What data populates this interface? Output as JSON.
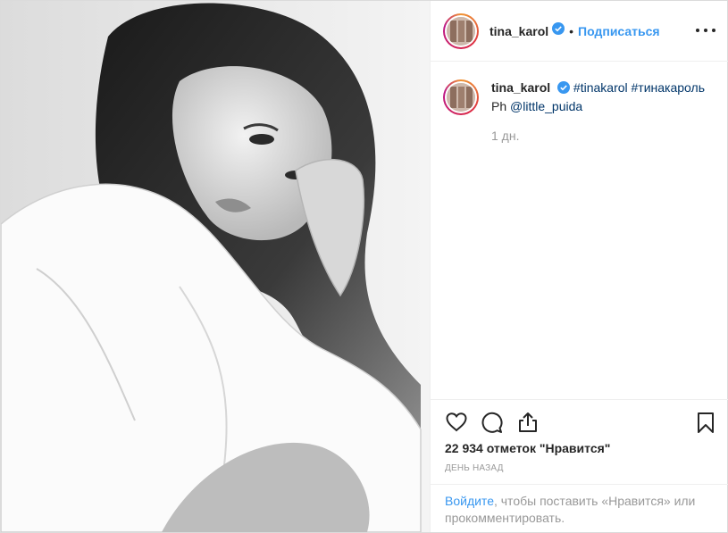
{
  "post": {
    "username": "tina_karol",
    "separator": "•",
    "follow_label": "Подписаться",
    "more_icon": "more-horizontal-icon",
    "verified_icon": "verified-badge-icon",
    "caption": {
      "username": "tina_karol",
      "hashtag1": "#tinakarol",
      "hashtag2": "#тинакароль",
      "ph_prefix": "Ph",
      "mention": "@little_puida",
      "time": "1 дн."
    },
    "likes_text": "22 934 отметок \"Нравится\"",
    "posted_ago": "ДЕНЬ НАЗАД",
    "login_link": "Войдите",
    "login_rest": ", чтобы поставить «Нравится» или прокомментировать."
  },
  "icons": [
    "heart-icon",
    "comment-icon",
    "share-icon",
    "bookmark-icon"
  ],
  "colors": {
    "link": "#3897f0",
    "hashtag": "#003569",
    "text": "#262626",
    "muted": "#999999",
    "border": "#efefef"
  }
}
